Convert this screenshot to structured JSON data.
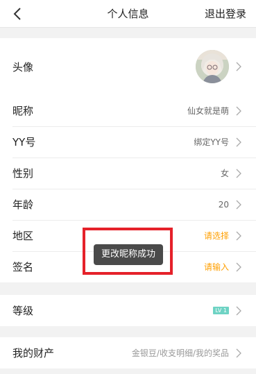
{
  "header": {
    "title": "个人信息",
    "logout_label": "退出登录",
    "back_icon": "chevron-left-icon"
  },
  "rows": {
    "avatar": {
      "label": "头像"
    },
    "nickname": {
      "label": "昵称",
      "value": "仙女就是萌"
    },
    "yy": {
      "label": "YY号",
      "value": "绑定YY号"
    },
    "gender": {
      "label": "性别",
      "value": "女"
    },
    "age": {
      "label": "年龄",
      "value": "20"
    },
    "region": {
      "label": "地区",
      "value": "请选择"
    },
    "signature": {
      "label": "签名",
      "value": "请输入"
    },
    "level": {
      "label": "等级",
      "badge": "LV 1"
    },
    "assets": {
      "label": "我的财产",
      "value": "金银豆/收支明细/我的奖品"
    }
  },
  "toast": {
    "text": "更改昵称成功"
  },
  "colors": {
    "accent_orange": "#ff9f00",
    "level_badge": "#6ed3c4",
    "highlight_red": "#e5212a",
    "toast_bg": "#4a4a4a"
  }
}
